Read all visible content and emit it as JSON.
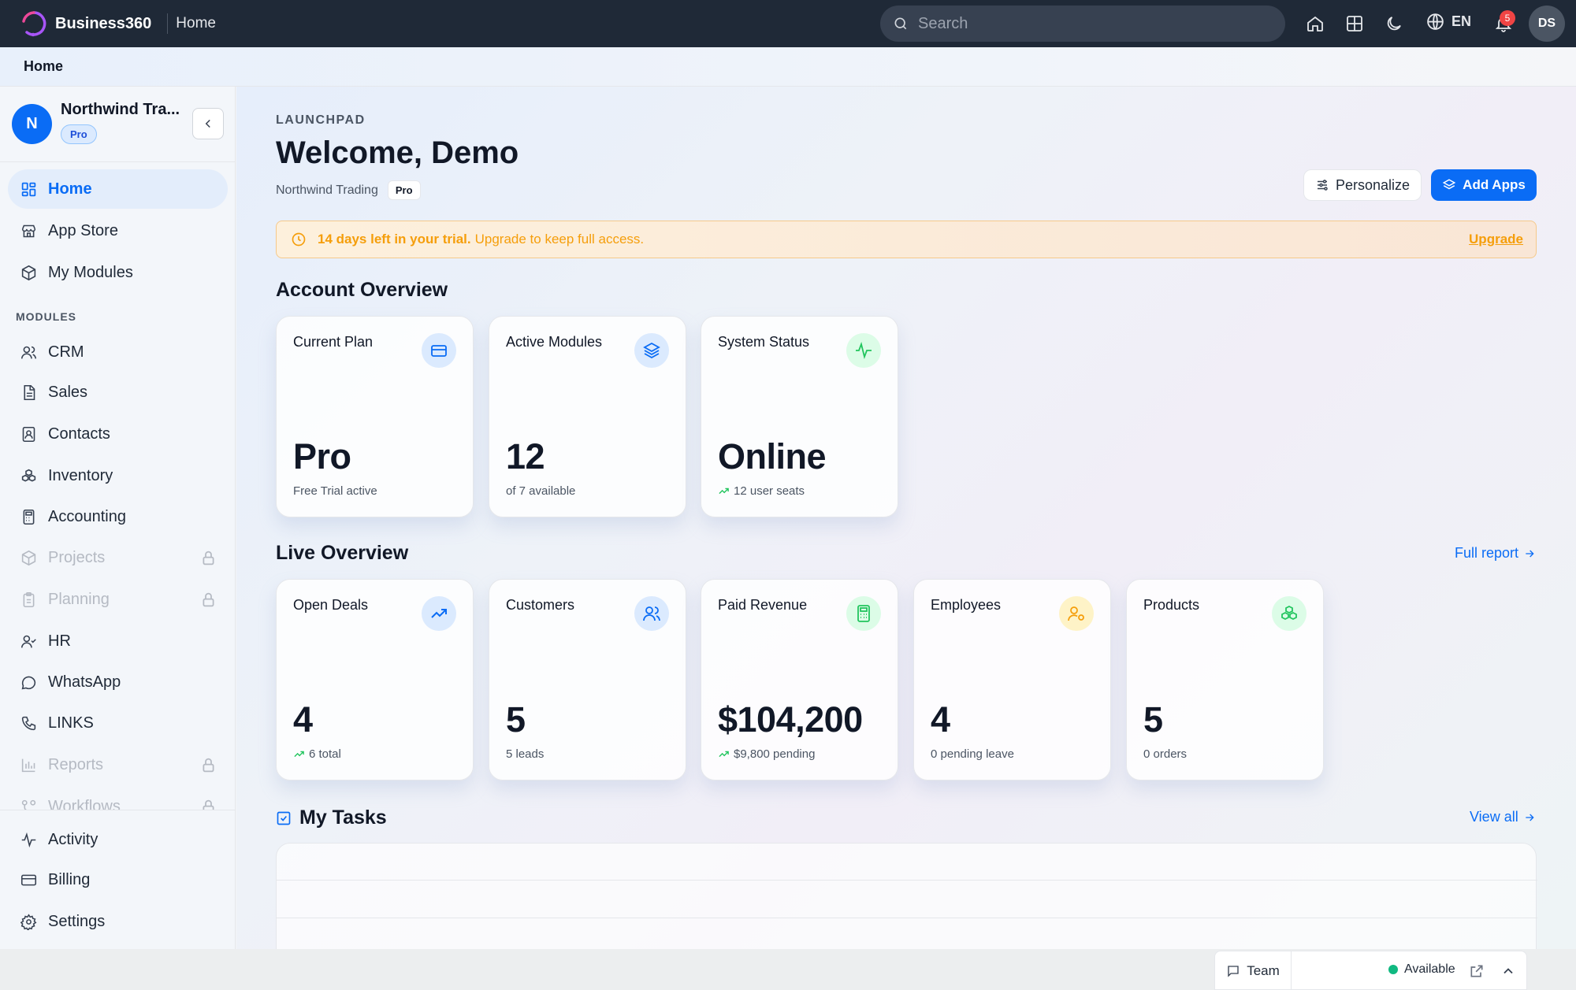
{
  "topbar": {
    "brand": "Business360",
    "crumb": "Home",
    "search_placeholder": "Search",
    "lang": "EN",
    "notif_count": "5",
    "user_initials": "DS"
  },
  "breadcrumb": {
    "current": "Home"
  },
  "sidebar": {
    "org_initial": "N",
    "org_name": "Northwind Tra...",
    "org_badge": "Pro",
    "top_items": [
      {
        "label": "Home",
        "icon": "grid-icon",
        "active": true
      },
      {
        "label": "App Store",
        "icon": "store-icon"
      },
      {
        "label": "My Modules",
        "icon": "box-icon"
      }
    ],
    "section_title": "MODULES",
    "module_items": [
      {
        "label": "CRM",
        "icon": "users-icon"
      },
      {
        "label": "Sales",
        "icon": "document-icon"
      },
      {
        "label": "Contacts",
        "icon": "contact-card-icon"
      },
      {
        "label": "Inventory",
        "icon": "boxes-icon"
      },
      {
        "label": "Accounting",
        "icon": "calculator-icon"
      },
      {
        "label": "Projects",
        "icon": "package-icon",
        "locked": true
      },
      {
        "label": "Planning",
        "icon": "clipboard-icon",
        "locked": true
      },
      {
        "label": "HR",
        "icon": "user-check-icon"
      },
      {
        "label": "WhatsApp",
        "icon": "chat-icon"
      },
      {
        "label": "LINKS",
        "icon": "phone-icon"
      },
      {
        "label": "Reports",
        "icon": "bar-chart-icon",
        "locked": true
      },
      {
        "label": "Workflows",
        "icon": "workflow-icon",
        "locked": true
      }
    ],
    "bottom_items": [
      {
        "label": "Activity",
        "icon": "activity-icon"
      },
      {
        "label": "Billing",
        "icon": "credit-card-icon"
      },
      {
        "label": "Settings",
        "icon": "gear-icon"
      }
    ]
  },
  "main": {
    "eyebrow": "LAUNCHPAD",
    "welcome": "Welcome, Demo",
    "company": "Northwind Trading",
    "plan_badge": "Pro",
    "personalize_label": "Personalize",
    "add_apps_label": "Add Apps",
    "trial": {
      "bold": "14 days left in your trial.",
      "rest": "Upgrade to keep full access.",
      "action": "Upgrade"
    },
    "account_overview": {
      "title": "Account Overview",
      "cards": [
        {
          "title": "Current Plan",
          "value": "Pro",
          "sub": "Free Trial active",
          "icon": "credit-card-icon",
          "color": "#0a6cf5",
          "bg": "#dbeafe",
          "trend": false
        },
        {
          "title": "Active Modules",
          "value": "12",
          "sub": "of 7 available",
          "icon": "layers-icon",
          "color": "#0a6cf5",
          "bg": "#dbeafe",
          "trend": false
        },
        {
          "title": "System Status",
          "value": "Online",
          "sub": "12 user seats",
          "icon": "activity-icon",
          "color": "#22c55e",
          "bg": "#dcfce7",
          "trend": true
        }
      ]
    },
    "live_overview": {
      "title": "Live Overview",
      "link": "Full report",
      "cards": [
        {
          "title": "Open Deals",
          "value": "4",
          "sub": "6 total",
          "icon": "trending-up-icon",
          "color": "#0a6cf5",
          "bg": "#dbeafe",
          "trend": true
        },
        {
          "title": "Customers",
          "value": "5",
          "sub": "5 leads",
          "icon": "users-icon",
          "color": "#0a6cf5",
          "bg": "#dbeafe",
          "trend": false
        },
        {
          "title": "Paid Revenue",
          "value": "$104,200",
          "sub": "$9,800 pending",
          "icon": "calculator-icon",
          "color": "#22c55e",
          "bg": "#dcfce7",
          "trend": true
        },
        {
          "title": "Employees",
          "value": "4",
          "sub": "0 pending leave",
          "icon": "user-cog-icon",
          "color": "#f59e0b",
          "bg": "#fef3c7",
          "trend": false
        },
        {
          "title": "Products",
          "value": "5",
          "sub": "0 orders",
          "icon": "boxes-icon",
          "color": "#22c55e",
          "bg": "#dcfce7",
          "trend": false
        }
      ]
    },
    "tasks": {
      "title": "My Tasks",
      "link": "View all"
    }
  },
  "team_bar": {
    "team_label": "Team",
    "status": "Available"
  }
}
